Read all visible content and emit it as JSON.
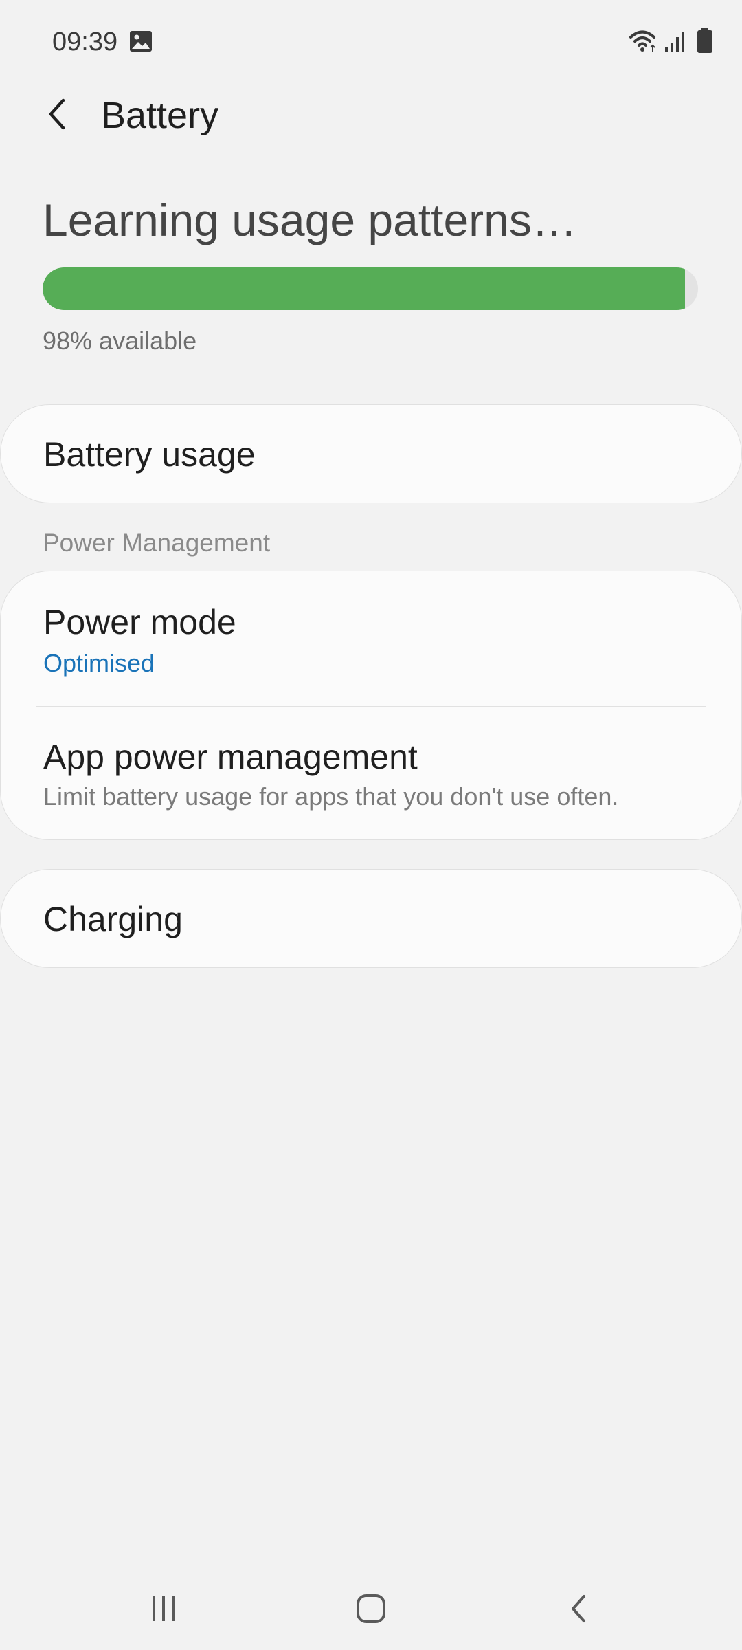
{
  "status_bar": {
    "time": "09:39",
    "icons": [
      "image-icon",
      "wifi-icon",
      "signal-icon",
      "battery-icon"
    ]
  },
  "header": {
    "title": "Battery",
    "back_icon": "chevron-left-icon"
  },
  "battery": {
    "headline": "Learning usage patterns…",
    "available_text": "98% available",
    "level": 0.98,
    "bar_color": "#56ad56"
  },
  "battery_usage": {
    "label": "Battery usage"
  },
  "power_management": {
    "section_label": "Power Management",
    "power_mode": {
      "title": "Power mode",
      "value": "Optimised",
      "value_color": "#1a73b8"
    },
    "app_power": {
      "title": "App power management",
      "subtitle": "Limit battery usage for apps that you don't use often."
    }
  },
  "charging": {
    "label": "Charging"
  },
  "nav_bar": {
    "buttons": [
      "recents-icon",
      "home-icon",
      "back-icon"
    ]
  }
}
